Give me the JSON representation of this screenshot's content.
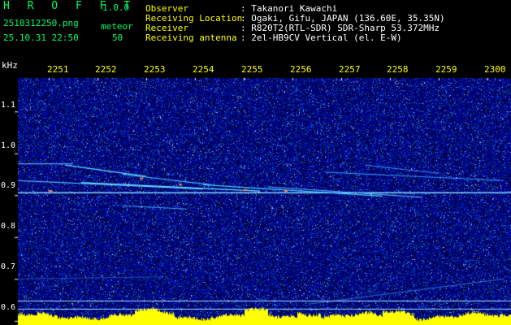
{
  "app": {
    "brand": "H R O F F T",
    "version": "1.0.0"
  },
  "file": {
    "name": "2510312250.png",
    "datetime": "25.10.31 22:50"
  },
  "meteor": {
    "label": "meteor",
    "count": "50"
  },
  "station": [
    {
      "label": "Observer",
      "value": ": Takanori Kawachi"
    },
    {
      "label": "Receiving Location",
      "value": ": Ogaki, Gifu, JAPAN (136.60E, 35.35N)"
    },
    {
      "label": "Receiver",
      "value": ": R820T2(RTL-SDR) SDR-Sharp 53.372MHz"
    },
    {
      "label": "Receiving antenna",
      "value": ": 2el-HB9CV Vertical (el. E-W)"
    }
  ],
  "axis": {
    "y_unit": "kHz",
    "time_ticks": [
      "2251",
      "2252",
      "2253",
      "2254",
      "2255",
      "2256",
      "2257",
      "2258",
      "2259",
      "2300"
    ],
    "freq_ticks": [
      {
        "value": 1.1,
        "label": "1.1"
      },
      {
        "value": 1.0,
        "label": "1.0"
      },
      {
        "value": 0.9,
        "label": "0.9"
      },
      {
        "value": 0.8,
        "label": "0.8"
      },
      {
        "value": 0.7,
        "label": "0.7"
      },
      {
        "value": 0.6,
        "label": "0.6"
      }
    ],
    "freq_range": [
      0.59,
      1.18
    ]
  },
  "colors": {
    "label_green": "#00ff66",
    "label_yellow": "#ffff00",
    "noise": "#0a1a9a",
    "carrier": "#66ccff",
    "level": "#ffff00"
  }
}
